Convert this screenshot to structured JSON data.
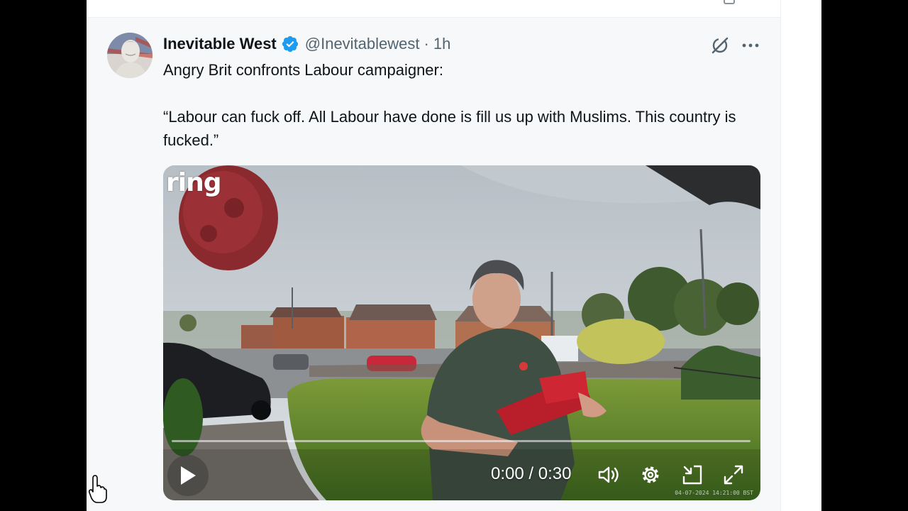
{
  "post": {
    "author_name": "Inevitable West",
    "handle": "@Inevitablewest",
    "separator": "·",
    "time": "1h",
    "text_line1": "Angry Brit confronts Labour campaigner:",
    "text_quote": "“Labour can fuck off. All Labour have done is fill us up with Muslims. This country is fucked.”"
  },
  "video": {
    "brand": "ring",
    "timecode": "0:00 / 0:30",
    "progress": 0,
    "camera_stamp": "04-07-2024 14:21:00 BST"
  },
  "icons": {
    "verified": "verified-badge-icon",
    "grok": "grok-icon",
    "more": "more-icon",
    "play": "play-icon",
    "volume": "volume-icon",
    "settings": "settings-icon",
    "pip": "picture-in-picture-icon",
    "fullscreen": "fullscreen-icon"
  },
  "colors": {
    "verified_blue": "#1d9bf0",
    "name": "#0f1419",
    "secondary": "#536471"
  }
}
